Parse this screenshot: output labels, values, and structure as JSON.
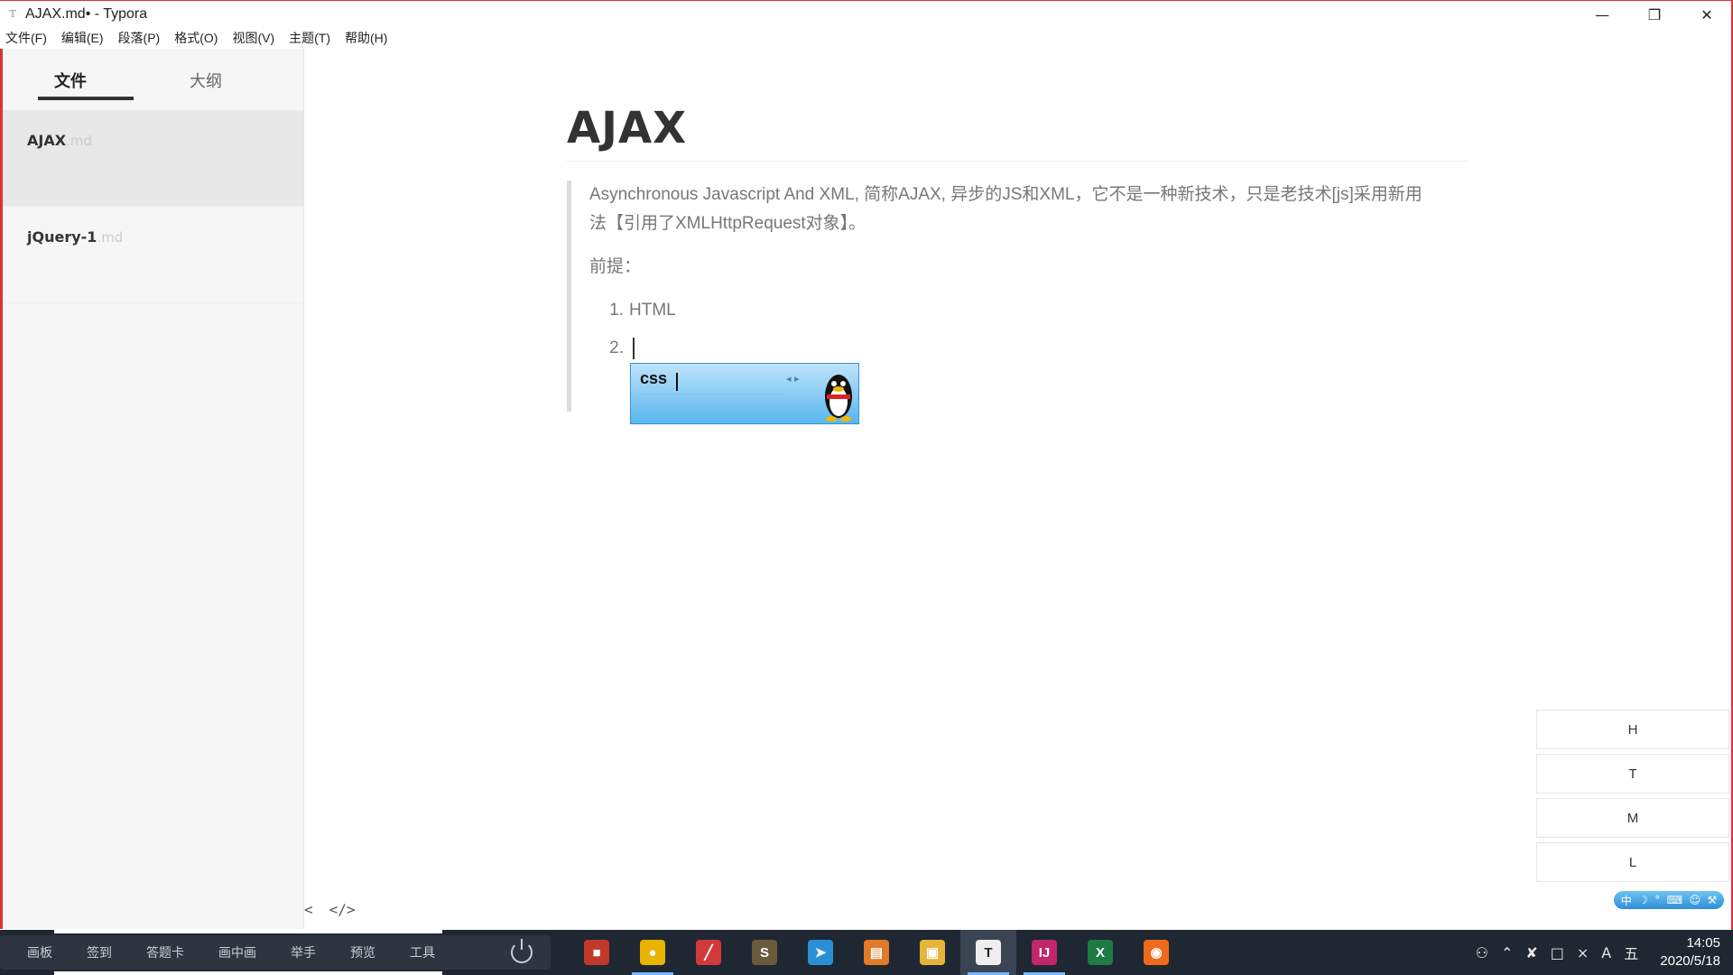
{
  "window": {
    "title": "AJAX.md• - Typora",
    "app_icon": "T",
    "minimize": "—",
    "restore": "❒",
    "close": "✕"
  },
  "menu": [
    "文件(F)",
    "编辑(E)",
    "段落(P)",
    "格式(O)",
    "视图(V)",
    "主题(T)",
    "帮助(H)"
  ],
  "sidebar": {
    "tabs": [
      {
        "label": "文件",
        "active": true
      },
      {
        "label": "大纲",
        "active": false
      }
    ],
    "files": [
      {
        "name": "AJAX",
        "ext": ".md",
        "active": true
      },
      {
        "name": "jQuery-1",
        "ext": ".md",
        "active": false
      }
    ],
    "footer": {
      "collapse": "<",
      "source": "</>"
    }
  },
  "document": {
    "heading": "AJAX",
    "paragraph": "Asynchronous Javascript And XML, 简称AJAX, 异步的JS和XML，它不是一种新技术，只是老技术[js]采用新用法【引用了XMLHttpRequest对象】。",
    "prereq": "前提：",
    "list": [
      {
        "num": "1.",
        "text": "HTML"
      },
      {
        "num": "2.",
        "text": ""
      }
    ]
  },
  "ime_popup": {
    "composition": "css",
    "arrows": "◂ ▸"
  },
  "heading_buttons": [
    "H",
    "T",
    "M",
    "L"
  ],
  "ime_status": [
    "中",
    "☽",
    "°",
    "⌨",
    "☺",
    "⚒"
  ],
  "class_toolbar": [
    "画板",
    "签到",
    "答题卡",
    "画中画",
    "举手",
    "预览",
    "工具"
  ],
  "taskbar_apps": [
    {
      "name": "red-app-icon",
      "glyph": "■",
      "color": "#c0392b",
      "running": false
    },
    {
      "name": "chrome-icon",
      "glyph": "●",
      "color": "#e8b400",
      "running": true
    },
    {
      "name": "paint-app-icon",
      "glyph": "╱",
      "color": "#d23a3a",
      "running": false
    },
    {
      "name": "sublime-icon",
      "glyph": "S",
      "color": "#6b5a3c",
      "running": false
    },
    {
      "name": "paper-plane-app-icon",
      "glyph": "➤",
      "color": "#2b8fd6",
      "running": false
    },
    {
      "name": "slides-app-icon",
      "glyph": "▤",
      "color": "#e27a2a",
      "running": false
    },
    {
      "name": "file-explorer-icon",
      "glyph": "▣",
      "color": "#e6b43a",
      "running": false
    },
    {
      "name": "typora-icon",
      "glyph": "T",
      "color": "#eeeeee",
      "running": true,
      "active": true
    },
    {
      "name": "intellij-icon",
      "glyph": "IJ",
      "color": "#c2266d",
      "running": true
    },
    {
      "name": "excel-icon",
      "glyph": "X",
      "color": "#1f7a43",
      "running": false
    },
    {
      "name": "firefox-icon",
      "glyph": "◉",
      "color": "#f06a1c",
      "running": false
    }
  ],
  "tray": {
    "icons": [
      "⚇",
      "⌃",
      "✘",
      "□",
      "⨯",
      "A",
      "五"
    ],
    "time": "14:05",
    "date": "2020/5/18"
  }
}
